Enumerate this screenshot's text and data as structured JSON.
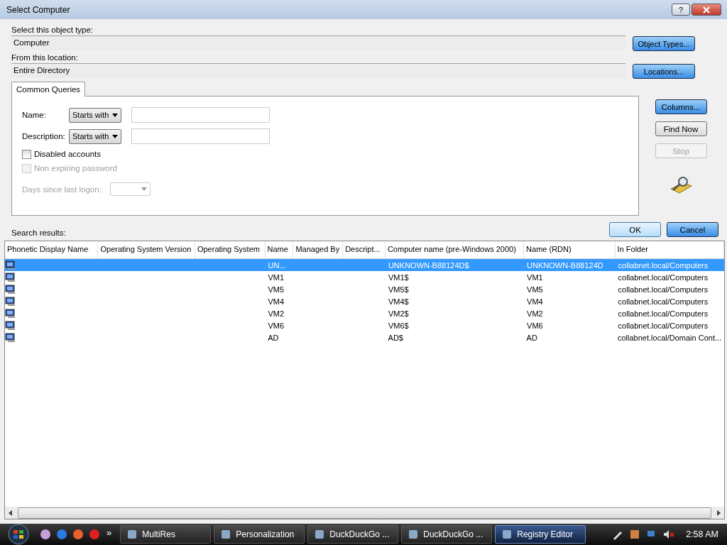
{
  "window": {
    "title": "Select Computer",
    "help": "?"
  },
  "object_type": {
    "label": "Select this object type:",
    "value": "Computer",
    "button": "Object Types..."
  },
  "location": {
    "label": "From this location:",
    "value": "Entire Directory",
    "button": "Locations..."
  },
  "tabs": [
    {
      "label": "Common Queries",
      "selected": true
    }
  ],
  "queries": {
    "fields": [
      {
        "label": "Name:",
        "mode": "Starts with"
      },
      {
        "label": "Description:",
        "mode": "Starts with"
      }
    ],
    "checkboxes": [
      {
        "label": "Disabled accounts",
        "checked": false,
        "disabled": false
      },
      {
        "label": "Non expiring password",
        "checked": false,
        "disabled": true
      }
    ],
    "days": {
      "label": "Days since last logon:",
      "disabled": true
    }
  },
  "side_buttons": [
    {
      "label": "Columns...",
      "disabled": false,
      "focused": true
    },
    {
      "label": "Find Now",
      "disabled": false,
      "focused": false
    },
    {
      "label": "Stop",
      "disabled": true,
      "focused": false
    }
  ],
  "results_label": "Search results:",
  "dialog_buttons": [
    {
      "label": "OK",
      "focused": false
    },
    {
      "label": "Cancel",
      "focused": true
    }
  ],
  "table": {
    "columns": [
      "Phonetic Display Name",
      "Operating System Version",
      "Operating System",
      "Name",
      "Managed By",
      "Descript...",
      "Computer name (pre-Windows 2000)",
      "Name (RDN)",
      "In Folder"
    ],
    "rows": [
      {
        "selected": true,
        "name": "UN...",
        "pre2000": "UNKNOWN-B88124D$",
        "rdn": "UNKNOWN-B88124D",
        "folder": "collabnet.local/Computers"
      },
      {
        "selected": false,
        "name": "VM1",
        "pre2000": "VM1$",
        "rdn": "VM1",
        "folder": "collabnet.local/Computers"
      },
      {
        "selected": false,
        "name": "VM5",
        "pre2000": "VM5$",
        "rdn": "VM5",
        "folder": "collabnet.local/Computers"
      },
      {
        "selected": false,
        "name": "VM4",
        "pre2000": "VM4$",
        "rdn": "VM4",
        "folder": "collabnet.local/Computers"
      },
      {
        "selected": false,
        "name": "VM2",
        "pre2000": "VM2$",
        "rdn": "VM2",
        "folder": "collabnet.local/Computers"
      },
      {
        "selected": false,
        "name": "VM6",
        "pre2000": "VM6$",
        "rdn": "VM6",
        "folder": "collabnet.local/Computers"
      },
      {
        "selected": false,
        "name": "AD",
        "pre2000": "AD$",
        "rdn": "AD",
        "folder": "collabnet.local/Domain Cont..."
      }
    ]
  },
  "taskbar": {
    "more": "»",
    "tasks": [
      {
        "label": "MultiRes",
        "selected": false
      },
      {
        "label": "Personalization",
        "selected": false
      },
      {
        "label": "DuckDuckGo ...",
        "selected": false
      },
      {
        "label": "DuckDuckGo ...",
        "selected": false
      },
      {
        "label": "Registry Editor",
        "selected": true
      }
    ],
    "clock": "2:58 AM"
  }
}
